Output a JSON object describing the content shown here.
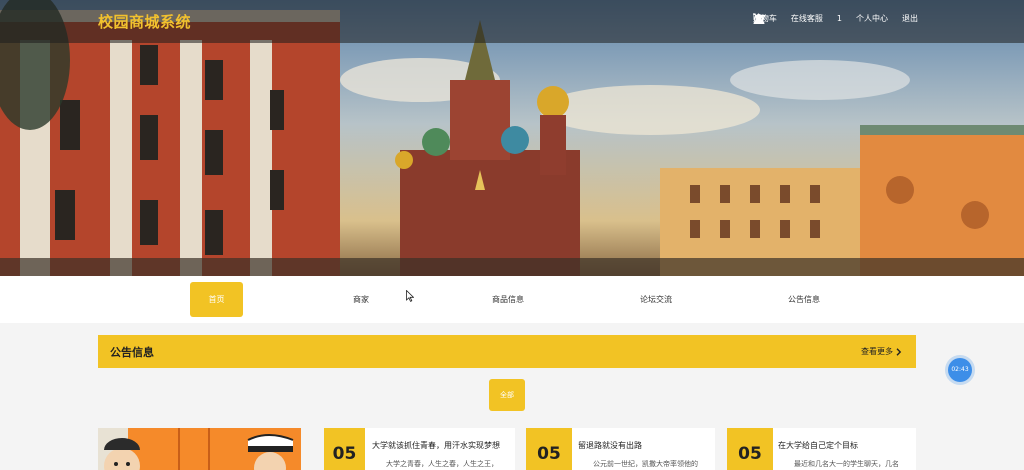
{
  "brand": {
    "name": "校园商城系统"
  },
  "topbar": {
    "links": [
      {
        "label": "购物车",
        "icon": "cart-icon"
      },
      {
        "label": "在线客服",
        "icon": "support-icon"
      },
      {
        "label": "1",
        "icon": ""
      },
      {
        "label": "个人中心",
        "icon": ""
      },
      {
        "label": "退出",
        "icon": "power-icon"
      }
    ]
  },
  "nav": {
    "items": [
      {
        "label": "首页",
        "active": true
      },
      {
        "label": "商家",
        "active": false
      },
      {
        "label": "商品信息",
        "active": false
      },
      {
        "label": "论坛交流",
        "active": false
      },
      {
        "label": "公告信息",
        "active": false
      }
    ]
  },
  "section": {
    "title": "公告信息",
    "more_label": "查看更多"
  },
  "filter": {
    "all_label": "全部"
  },
  "timer": {
    "text": "02:43"
  },
  "news": [
    {
      "day": "05",
      "title": "大学就该抓住青春，用汗水实现梦想",
      "desc": "大学之青春，人生之春，人生之王，"
    },
    {
      "day": "05",
      "title": "留退路就没有出路",
      "desc": "公元前一世纪，凯撒大帝率领他的"
    },
    {
      "day": "05",
      "title": "在大学给自己定个目标",
      "desc": "最近和几名大一的学生聊天，几名"
    }
  ],
  "colors": {
    "accent": "#f2c324",
    "brand": "#f2c12e",
    "timer": "#3d8ee8"
  }
}
